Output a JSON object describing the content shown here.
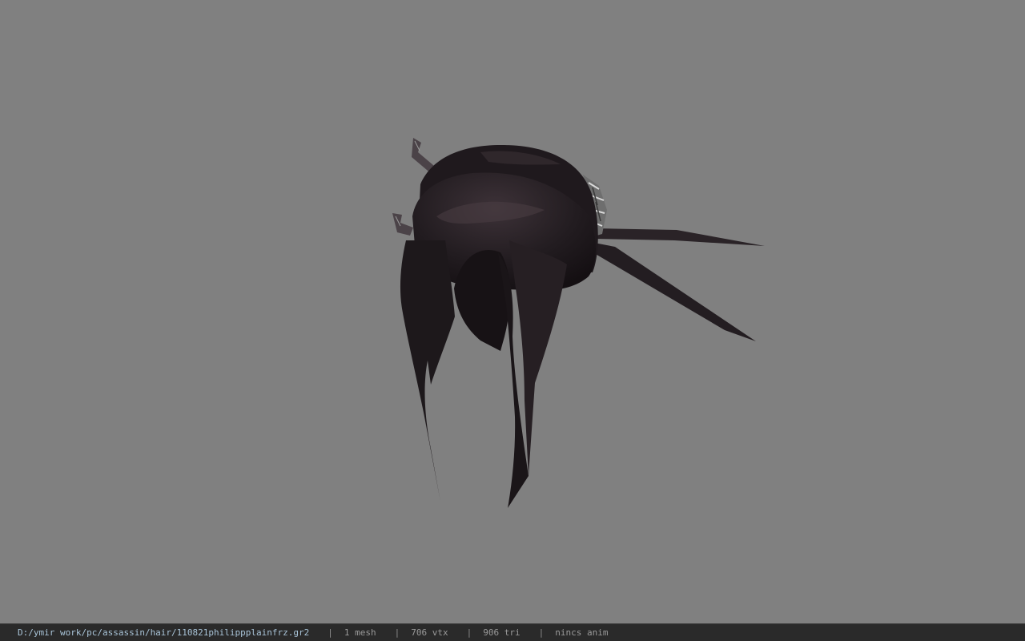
{
  "viewer": {
    "background_color": "#808080",
    "model_icon": "hair-model-icon"
  },
  "status": {
    "file_path": "D:/ymir work/pc/assassin/hair/110821philippplainfrz.gr2",
    "separator": "|",
    "mesh_count": "1 mesh",
    "vertex_count": "706 vtx",
    "triangle_count": "906 tri",
    "animation": "nincs anim"
  }
}
